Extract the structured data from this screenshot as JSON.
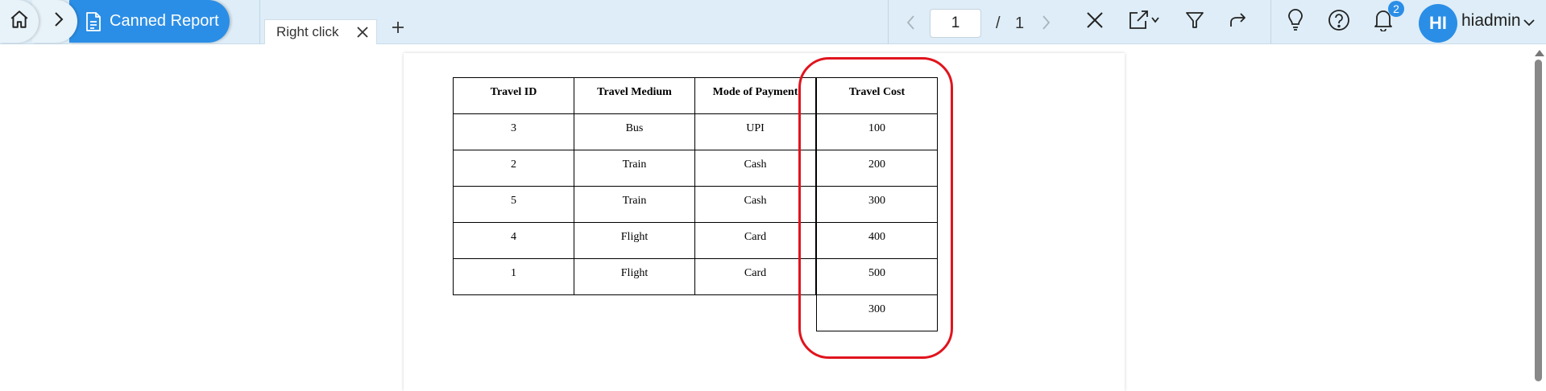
{
  "header": {
    "breadcrumb_active": "Canned Report",
    "tab_label": "Right click",
    "pager": {
      "current_page": "1",
      "separator": "/",
      "total_pages": "1"
    },
    "notification_count": "2",
    "avatar_initials": "HI",
    "username": "hiadmin"
  },
  "report": {
    "columns": [
      "Travel ID",
      "Travel Medium",
      "Mode of Payment",
      "Travel Cost"
    ],
    "rows": [
      [
        "3",
        "Bus",
        "UPI",
        "100"
      ],
      [
        "2",
        "Train",
        "Cash",
        "200"
      ],
      [
        "5",
        "Train",
        "Cash",
        "300"
      ],
      [
        "4",
        "Flight",
        "Card",
        "400"
      ],
      [
        "1",
        "Flight",
        "Card",
        "500"
      ]
    ],
    "total_cost": "300"
  },
  "colors": {
    "accent": "#2b8ee6",
    "topbar": "#deedf7",
    "highlight": "#e0141e"
  },
  "icons": [
    "home-icon",
    "chevron-right-icon",
    "document-icon",
    "close-icon",
    "plus-icon",
    "chevron-left-icon",
    "chevron-right-icon",
    "close-report-icon",
    "export-icon",
    "filter-icon",
    "share-icon",
    "lightbulb-icon",
    "help-icon",
    "bell-icon",
    "chevron-down-icon"
  ]
}
